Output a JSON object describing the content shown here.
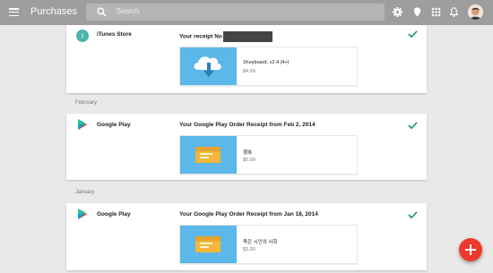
{
  "topbar": {
    "title": "Purchases",
    "search_placeholder": "Search"
  },
  "receipts": [
    {
      "store": "iTunes Store",
      "title": "Your receipt No",
      "item_name": "1Keyboard, v2.4 (4+)",
      "item_price": "$4.99"
    },
    {
      "month": "February",
      "store": "Google Play",
      "title": "Your Google Play Order Receipt from Feb 2, 2014",
      "item_name": "행복",
      "item_price": "$0.00"
    },
    {
      "month": "January",
      "store": "Google Play",
      "title": "Your Google Play Order Receipt from Jan 18, 2014",
      "item_name": "죽은 시인의 사회",
      "item_price": "$3.30"
    }
  ],
  "colors": {
    "topbar": "#9e9e9e",
    "check": "#1e9c68",
    "fab": "#ee3a2c",
    "thumb_blue": "#5cb8e8"
  },
  "icons": [
    "menu-icon",
    "search-icon",
    "settings-icon",
    "location-icon",
    "apps-icon",
    "notifications-icon",
    "check-icon",
    "download-cloud-icon",
    "folder-icon",
    "play-store-icon",
    "add-icon"
  ]
}
